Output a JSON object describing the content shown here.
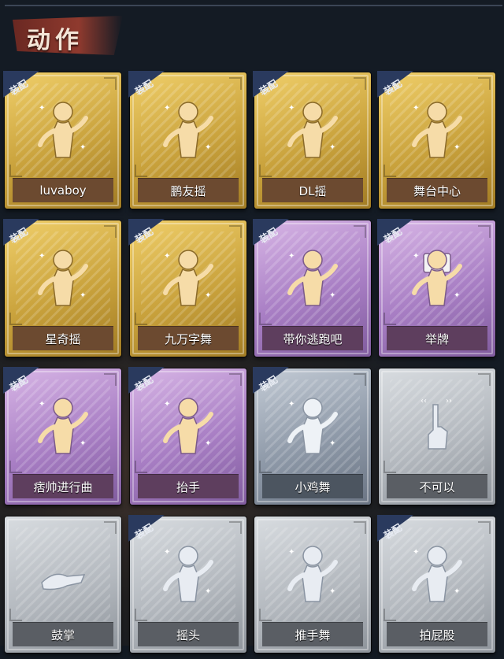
{
  "header": {
    "title": "动作"
  },
  "equip_label": "装配",
  "colors": {
    "gold": "#d4ad48",
    "purple": "#a87ec4",
    "silver": "#8e99a8",
    "white": "#b4b9bf",
    "badge": "#2a3a5e",
    "title_plate": "#8f3a2e"
  },
  "cards": [
    {
      "label": "luvaboy",
      "rarity": "gold",
      "equipped": true,
      "icon": "dance-pose-icon"
    },
    {
      "label": "鹏友摇",
      "rarity": "gold",
      "equipped": true,
      "icon": "dance-pose-icon"
    },
    {
      "label": "DL摇",
      "rarity": "gold",
      "equipped": true,
      "icon": "dance-pose-icon"
    },
    {
      "label": "舞台中心",
      "rarity": "gold",
      "equipped": true,
      "icon": "dance-pose-icon"
    },
    {
      "label": "星奇摇",
      "rarity": "gold",
      "equipped": true,
      "icon": "dance-pose-icon"
    },
    {
      "label": "九万字舞",
      "rarity": "gold",
      "equipped": true,
      "icon": "dance-pose-icon"
    },
    {
      "label": "带你逃跑吧",
      "rarity": "purple",
      "equipped": true,
      "icon": "dance-pose-icon"
    },
    {
      "label": "举牌",
      "rarity": "purple",
      "equipped": true,
      "icon": "sign-holding-icon"
    },
    {
      "label": "痞帅进行曲",
      "rarity": "purple",
      "equipped": true,
      "icon": "dance-pose-icon"
    },
    {
      "label": "抬手",
      "rarity": "purple",
      "equipped": true,
      "icon": "raise-hand-icon"
    },
    {
      "label": "小鸡舞",
      "rarity": "silver",
      "equipped": true,
      "icon": "chicken-dance-icon"
    },
    {
      "label": "不可以",
      "rarity": "white",
      "equipped": false,
      "icon": "finger-wag-icon"
    },
    {
      "label": "鼓掌",
      "rarity": "white",
      "equipped": false,
      "icon": "clap-icon"
    },
    {
      "label": "摇头",
      "rarity": "white",
      "equipped": true,
      "icon": "head-shake-icon"
    },
    {
      "label": "推手舞",
      "rarity": "white",
      "equipped": false,
      "icon": "push-hand-dance-icon"
    },
    {
      "label": "拍屁股",
      "rarity": "white",
      "equipped": true,
      "icon": "butt-slap-icon"
    }
  ]
}
